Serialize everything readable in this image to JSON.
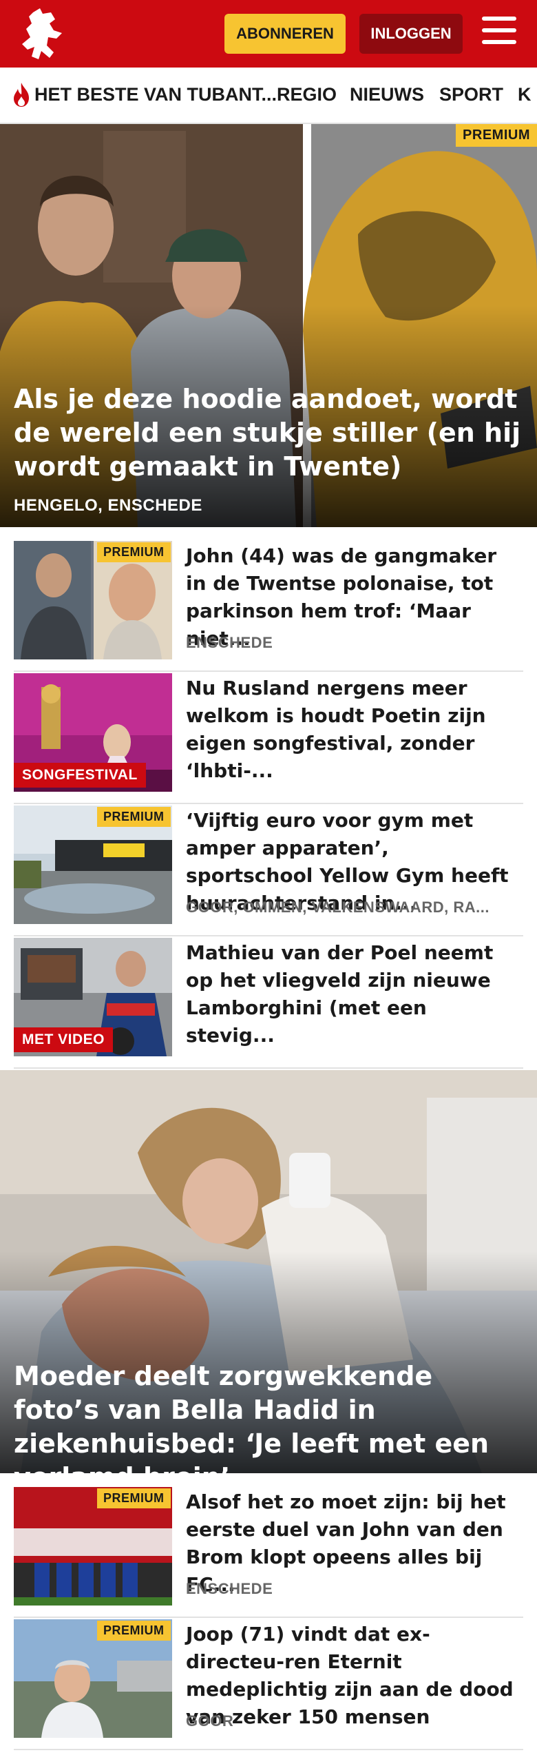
{
  "header": {
    "subscribe_label": "ABONNEREN",
    "login_label": "INLOGGEN",
    "brand_color": "#cc0a11",
    "accent_color": "#f7c431"
  },
  "nav": {
    "items": [
      "HET BESTE VAN TUBANT...",
      "REGIO",
      "NIEUWS",
      "SPORT",
      "K"
    ]
  },
  "hero1": {
    "badge": "PREMIUM",
    "title": "Als je deze hoodie aandoet, wordt de wereld een stukje stiller (en hij wordt gemaakt in Twente)",
    "location": "HENGELO, ENSCHEDE"
  },
  "articles1": [
    {
      "badge": "PREMIUM",
      "title": "John (44) was de gangmaker in de Twentse polonaise, tot parkinson hem trof: ‘Maar niet...",
      "location": "ENSCHEDE"
    },
    {
      "badge": "SONGFESTIVAL",
      "title": "Nu Rusland nergens meer welkom is houdt Poetin zijn eigen songfestival, zonder ‘lhbti-...",
      "location": ""
    },
    {
      "badge": "PREMIUM",
      "title": "‘Vijftig euro voor gym met amper apparaten’, sportschool Yellow Gym heeft huurachterstand in...",
      "location": "GOOR, OMMEN, VALKENSWAARD, RA..."
    },
    {
      "badge": "MET VIDEO",
      "title": "Mathieu van der Poel neemt op het vliegveld zijn nieuwe Lamborghini (met een stevig...",
      "location": ""
    }
  ],
  "hero2": {
    "title": "Moeder deelt zorgwekkende foto’s van Bella Hadid in ziekenhuisbed: ‘Je leeft met een verlamd brein’"
  },
  "articles2": [
    {
      "badge": "PREMIUM",
      "title": "Alsof het zo moet zijn: bij het eerste duel van John van den Brom klopt opeens alles bij FC...",
      "location": "ENSCHEDE"
    },
    {
      "badge": "PREMIUM",
      "title": "Joop (71) vindt dat ex-directeu-ren Eternit medeplichtig zijn aan de dood van zeker 150 mensen",
      "location": "GOOR"
    }
  ]
}
